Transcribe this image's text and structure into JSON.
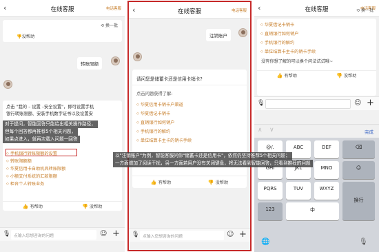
{
  "header": {
    "title": "在线客服",
    "hint": "电话客服"
  },
  "panel1": {
    "feedback_no": "没帮助",
    "refresh": "换一批",
    "user_msg": "转账限额",
    "reply_line1": "点击 \"我的 – 设置 –安全设置\"，即可设置手机",
    "reply_line2": "银行转账限额、安装手机数字证书以及设置安",
    "annot1": "对于提问，智能回答只能给出相关操作路径，",
    "annot2": "但每个回答都再推荐5个相关问题，",
    "annot3": "如果点进入，就再次载入问题一回答",
    "questions": [
      "手机银行转账限额的设置",
      "转账限额额",
      "华夏信用卡自助机具转账限额",
      "小额支付系统的汇款限额",
      "柜台个人转账业务"
    ],
    "feedback_yes": "有帮助",
    "feedback_no2": "没帮助",
    "input_placeholder": "点输入您想咨询的问题"
  },
  "panel2": {
    "user_msg": "注销账户",
    "ask": "请问您是储蓄卡还是信用卡销卡?",
    "intro": "点击问题获得了解:",
    "questions": [
      "华夏信用卡销卡户渠道",
      "华夏借记卡销卡",
      "直销银行如何销户",
      "手机银行的解约",
      "单位结算卡主卡的销卡手续"
    ],
    "feedback_yes": "有帮助",
    "feedback_no": "没帮助",
    "input_placeholder": "点输入您想咨询的问题"
  },
  "panel3": {
    "questions": [
      "华夏借记卡销卡",
      "直销银行如何销户",
      "手机银行的解约",
      "单位结算卡主卡的销卡手续"
    ],
    "not_found": "没有你想了解的可以换个问法试试哦~",
    "feedback_yes": "有帮助",
    "feedback_no": "没帮助",
    "done": "完成",
    "refresh": "换一批",
    "keys": {
      "r1": [
        "@/.",
        "ABC",
        "DEF"
      ],
      "r2": [
        "GHI",
        "JKL",
        "MNO"
      ],
      "r3": [
        "PQRS",
        "TUV",
        "WXYZ"
      ],
      "r4": [
        "123",
        "中",
        "换行"
      ],
      "r1_sub": [
        "1",
        "2",
        "3"
      ],
      "r2_sub": [
        "4",
        "5",
        "6"
      ],
      "r3_sub": [
        "7",
        "8",
        "9"
      ],
      "r4_sub": [
        "",
        "英",
        ""
      ],
      "backspace": "⌫"
    }
  },
  "bottom_annot": {
    "line1": "以\"注销账户\"为例，智能客服问你\"储蓄卡还是信用卡\"，依然仍坚持推荐5个相关问题；",
    "line2": "一方面增加了阅读干扰，另一方面若用户没有关闭键盘，将无法看到智能回答，只看到推荐的问题"
  },
  "colors": {
    "accent": "#c77e2a",
    "annot_bg": "#3c3c3c",
    "frame": "#c62828"
  }
}
